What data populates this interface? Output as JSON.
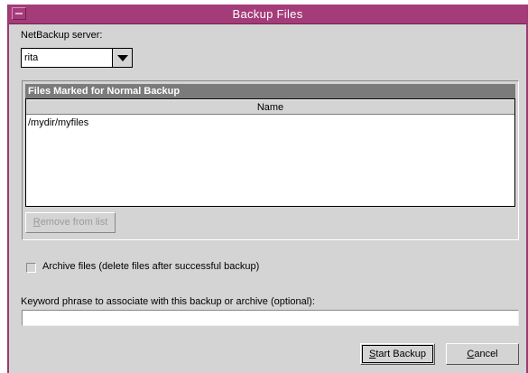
{
  "window": {
    "title": "Backup Files"
  },
  "server": {
    "label": "NetBackup server:",
    "value": "rita"
  },
  "files_group": {
    "header": "Files Marked for Normal Backup",
    "column_name": "Name",
    "rows": [
      "/mydir/myfiles"
    ],
    "remove_button": {
      "mnemonic": "R",
      "rest": "emove from list",
      "enabled": false
    }
  },
  "archive": {
    "label": "Archive files (delete files after successful backup)",
    "checked": false
  },
  "keyword": {
    "label": "Keyword phrase to associate with this backup or archive (optional):",
    "value": ""
  },
  "buttons": {
    "start": {
      "mnemonic": "S",
      "rest": "tart Backup"
    },
    "cancel": {
      "mnemonic": "C",
      "rest": "ancel"
    }
  },
  "colors": {
    "titlebar": "#a53c7a",
    "background": "#d4d4d4",
    "group_header": "#7b7b7b"
  }
}
